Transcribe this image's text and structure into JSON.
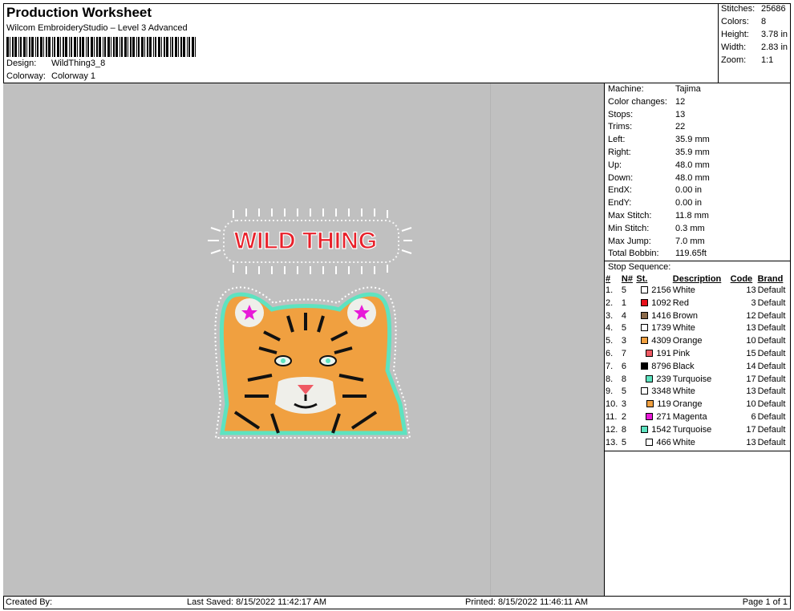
{
  "header": {
    "title": "Production Worksheet",
    "subtitle": "Wilcom EmbroideryStudio – Level 3 Advanced",
    "design_label": "Design:",
    "design_value": "WildThing3_8",
    "colorway_label": "Colorway:",
    "colorway_value": "Colorway 1"
  },
  "summary": {
    "stitches_label": "Stitches:",
    "stitches": "25686",
    "colors_label": "Colors:",
    "colors": "8",
    "height_label": "Height:",
    "height": "3.78 in",
    "width_label": "Width:",
    "width": "2.83 in",
    "zoom_label": "Zoom:",
    "zoom": "1:1"
  },
  "design": {
    "text": "WILD THING"
  },
  "machine_info": [
    {
      "label": "Machine:",
      "value": "Tajima"
    },
    {
      "label": "Color changes:",
      "value": "12"
    },
    {
      "label": "Stops:",
      "value": "13"
    },
    {
      "label": "Trims:",
      "value": "22"
    },
    {
      "label": "Left:",
      "value": "35.9 mm"
    },
    {
      "label": "Right:",
      "value": "35.9 mm"
    },
    {
      "label": "Up:",
      "value": "48.0 mm"
    },
    {
      "label": "Down:",
      "value": "48.0 mm"
    },
    {
      "label": "EndX:",
      "value": "0.00 in"
    },
    {
      "label": "EndY:",
      "value": "0.00 in"
    },
    {
      "label": "Max Stitch:",
      "value": "11.8 mm"
    },
    {
      "label": "Min Stitch:",
      "value": "0.3 mm"
    },
    {
      "label": "Max Jump:",
      "value": "7.0 mm"
    },
    {
      "label": "Total Bobbin:",
      "value": "119.65ft"
    }
  ],
  "stop_sequence": {
    "title": "Stop Sequence:",
    "columns": [
      "#",
      "N#",
      "St.",
      "Description",
      "Code",
      "Brand"
    ],
    "rows": [
      {
        "num": "1.",
        "n": "5",
        "color": "#ffffff",
        "st": "2156",
        "desc": "White",
        "code": "13",
        "brand": "Default"
      },
      {
        "num": "2.",
        "n": "1",
        "color": "#e8101a",
        "st": "1092",
        "desc": "Red",
        "code": "3",
        "brand": "Default"
      },
      {
        "num": "3.",
        "n": "4",
        "color": "#8b6a4a",
        "st": "1416",
        "desc": "Brown",
        "code": "12",
        "brand": "Default"
      },
      {
        "num": "4.",
        "n": "5",
        "color": "#ffffff",
        "st": "1739",
        "desc": "White",
        "code": "13",
        "brand": "Default"
      },
      {
        "num": "5.",
        "n": "3",
        "color": "#f0a040",
        "st": "4309",
        "desc": "Orange",
        "code": "10",
        "brand": "Default"
      },
      {
        "num": "6.",
        "n": "7",
        "color": "#ef5a64",
        "st": "191",
        "desc": "Pink",
        "code": "15",
        "brand": "Default"
      },
      {
        "num": "7.",
        "n": "6",
        "color": "#000000",
        "st": "8796",
        "desc": "Black",
        "code": "14",
        "brand": "Default"
      },
      {
        "num": "8.",
        "n": "8",
        "color": "#5ee3c0",
        "st": "239",
        "desc": "Turquoise",
        "code": "17",
        "brand": "Default"
      },
      {
        "num": "9.",
        "n": "5",
        "color": "#ffffff",
        "st": "3348",
        "desc": "White",
        "code": "13",
        "brand": "Default"
      },
      {
        "num": "10.",
        "n": "3",
        "color": "#f0a040",
        "st": "119",
        "desc": "Orange",
        "code": "10",
        "brand": "Default"
      },
      {
        "num": "11.",
        "n": "2",
        "color": "#e81ad8",
        "st": "271",
        "desc": "Magenta",
        "code": "6",
        "brand": "Default"
      },
      {
        "num": "12.",
        "n": "8",
        "color": "#5ee3c0",
        "st": "1542",
        "desc": "Turquoise",
        "code": "17",
        "brand": "Default"
      },
      {
        "num": "13.",
        "n": "5",
        "color": "#ffffff",
        "st": "466",
        "desc": "White",
        "code": "13",
        "brand": "Default"
      }
    ]
  },
  "footer": {
    "created_by": "Created By:",
    "last_saved": "Last Saved: 8/15/2022 11:42:17 AM",
    "printed": "Printed: 8/15/2022 11:46:11 AM",
    "page": "Page 1 of 1"
  }
}
